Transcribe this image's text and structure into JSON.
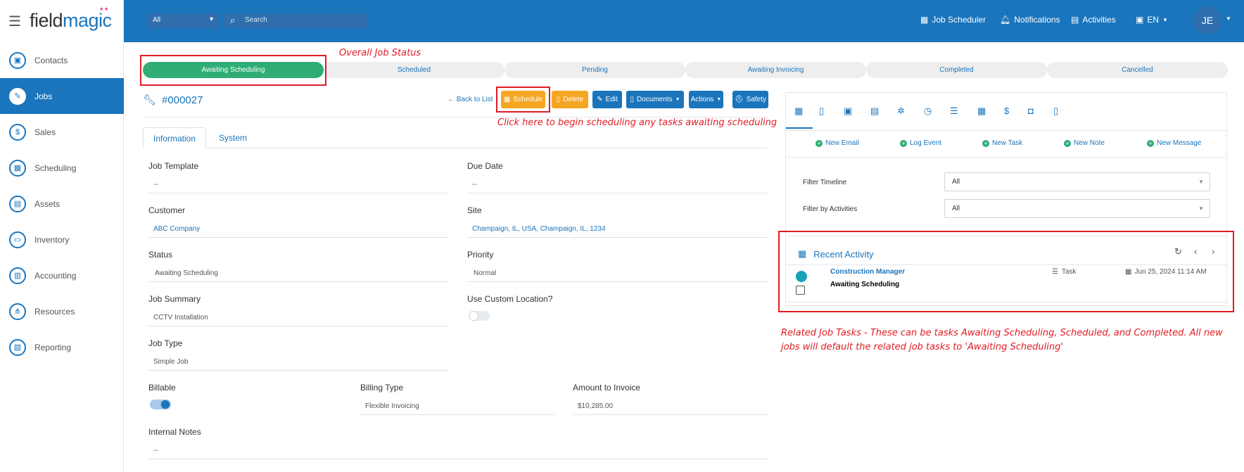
{
  "app": {
    "logo_part1": "field",
    "logo_part2": "magic"
  },
  "sidebar": {
    "items": [
      {
        "label": "Contacts",
        "icon": "contacts-icon"
      },
      {
        "label": "Jobs",
        "icon": "wrench-icon"
      },
      {
        "label": "Sales",
        "icon": "dollar-icon"
      },
      {
        "label": "Scheduling",
        "icon": "calendar-icon"
      },
      {
        "label": "Assets",
        "icon": "briefcase-icon"
      },
      {
        "label": "Inventory",
        "icon": "box-icon"
      },
      {
        "label": "Accounting",
        "icon": "wallet-icon"
      },
      {
        "label": "Resources",
        "icon": "network-icon"
      },
      {
        "label": "Reporting",
        "icon": "report-icon"
      }
    ],
    "active": "Jobs"
  },
  "topbar": {
    "search_scope": "All",
    "search_placeholder": "Search",
    "job_scheduler": "Job Scheduler",
    "notifications": "Notifications",
    "activities": "Activities",
    "language": "EN",
    "avatar": "JE"
  },
  "stages": {
    "items": [
      "Awaiting Scheduling",
      "Scheduled",
      "Pending",
      "Awaiting Invoicing",
      "Completed",
      "Cancelled"
    ],
    "active_index": 0
  },
  "annotations": {
    "overall_status": "Overall Job Status",
    "schedule_hint": "Click here to begin scheduling any tasks awaiting scheduling",
    "related_tasks_1": "Related Job Tasks - These can be tasks Awaiting Scheduling, Scheduled, and Completed. All new",
    "related_tasks_2": "jobs will default the related job tasks to 'Awaiting Scheduling'"
  },
  "job": {
    "id": "#000027",
    "back": "Back to List",
    "buttons": {
      "schedule": "Schedule",
      "delete": "Delete",
      "edit": "Edit",
      "documents": "Documents",
      "actions": "Actions",
      "safety": "Safety"
    },
    "tabs": [
      "Information",
      "System"
    ]
  },
  "form": {
    "job_template": {
      "label": "Job Template",
      "value": "--"
    },
    "due_date": {
      "label": "Due Date",
      "value": "--"
    },
    "customer": {
      "label": "Customer",
      "value": "ABC Company"
    },
    "site": {
      "label": "Site",
      "value": "Champaign, IL, USA, Champaign, IL, 1234"
    },
    "status": {
      "label": "Status",
      "value": "Awaiting Scheduling"
    },
    "priority": {
      "label": "Priority",
      "value": "Normal"
    },
    "job_summary": {
      "label": "Job Summary",
      "value": "CCTV Installation"
    },
    "custom_location": {
      "label": "Use Custom Location?",
      "on": false
    },
    "job_type": {
      "label": "Job Type",
      "value": "Simple Job"
    },
    "billable": {
      "label": "Billable",
      "on": true
    },
    "billing_type": {
      "label": "Billing Type",
      "value": "Flexible Invoicing"
    },
    "amount": {
      "label": "Amount to Invoice",
      "value": "$10,285.00"
    },
    "internal_notes": {
      "label": "Internal Notes",
      "value": "--"
    }
  },
  "panel": {
    "icons": [
      "calendar-icon",
      "file-icon",
      "contact-card-icon",
      "list-icon",
      "handshake-icon",
      "clock-icon",
      "checklist-icon",
      "calendar-day-icon",
      "dollar-icon",
      "bag-icon",
      "document-icon"
    ],
    "quick_actions": [
      "New Email",
      "Log Event",
      "New Task",
      "New Note",
      "New Message"
    ],
    "filter_timeline": {
      "label": "Filter Timeline",
      "value": "All"
    },
    "filter_activities": {
      "label": "Filter by Activities",
      "value": "All"
    },
    "recent": {
      "title": "Recent Activity",
      "item": {
        "who": "Construction Manager",
        "what": "Awaiting Scheduling",
        "type": "Task",
        "date": "Jun 25, 2024 11:14 AM"
      }
    }
  },
  "colors": {
    "brand": "#1a75bc",
    "success": "#2fad75",
    "warning": "#f5a623",
    "annotation": "#e01b24"
  }
}
